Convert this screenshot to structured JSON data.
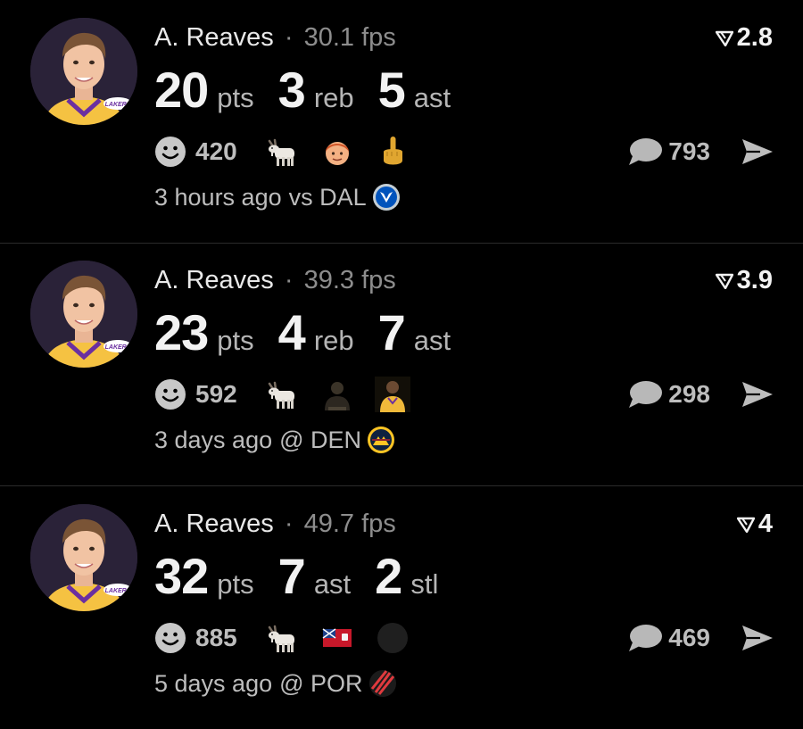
{
  "posts": [
    {
      "player": "A. Reaves",
      "separator": "·",
      "fps": "30.1 fps",
      "rating": "2.8",
      "stats": [
        {
          "value": "20",
          "label": "pts"
        },
        {
          "value": "3",
          "label": "reb"
        },
        {
          "value": "5",
          "label": "ast"
        }
      ],
      "reaction_count": "420",
      "reaction_emojis": [
        "goat-emoji",
        "man-red-hair-emoji",
        "middle-finger-emoji"
      ],
      "comment_count": "793",
      "time": "3 hours ago",
      "matchup": "vs DAL",
      "team_logo": "mavericks-logo-icon"
    },
    {
      "player": "A. Reaves",
      "separator": "·",
      "fps": "39.3 fps",
      "rating": "3.9",
      "stats": [
        {
          "value": "23",
          "label": "pts"
        },
        {
          "value": "4",
          "label": "reb"
        },
        {
          "value": "7",
          "label": "ast"
        }
      ],
      "reaction_count": "592",
      "reaction_emojis": [
        "goat-emoji",
        "dark-figure-emoji",
        "player-photo-emoji"
      ],
      "comment_count": "298",
      "time": "3 days ago",
      "matchup": "@ DEN",
      "team_logo": "nuggets-logo-icon"
    },
    {
      "player": "A. Reaves",
      "separator": "·",
      "fps": "49.7 fps",
      "rating": "4",
      "stats": [
        {
          "value": "32",
          "label": "pts"
        },
        {
          "value": "7",
          "label": "ast"
        },
        {
          "value": "2",
          "label": "stl"
        }
      ],
      "reaction_count": "885",
      "reaction_emojis": [
        "goat-emoji",
        "flag-emoji",
        "dark-circle-emoji"
      ],
      "comment_count": "469",
      "time": "5 days ago",
      "matchup": "@ POR",
      "team_logo": "blazers-logo-icon"
    }
  ],
  "colors": {
    "background": "#000000",
    "primary_text": "#f2f2f2",
    "secondary_text": "#8d8d8d",
    "divider": "#2b2b2b",
    "lakers_gold": "#f5c242"
  }
}
